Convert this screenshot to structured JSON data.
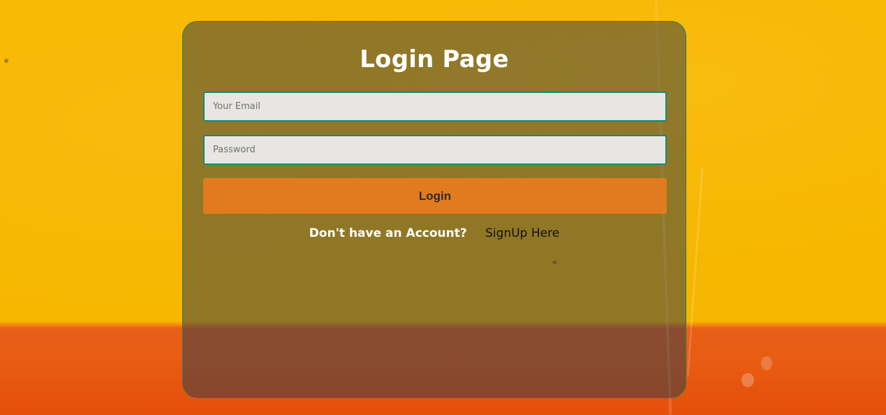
{
  "login_page": {
    "title": "Login Page",
    "email_placeholder": "Your Email",
    "password_placeholder": "Password",
    "login_label": "Login",
    "account_prompt": "Don't have an Account?",
    "signup_label": "SignUp Here"
  },
  "colors": {
    "background_yellow": "#f8b800",
    "background_orange": "#e85b12",
    "card_overlay": "#323c46",
    "field_border": "#138a7a",
    "button": "#e27b1f"
  }
}
